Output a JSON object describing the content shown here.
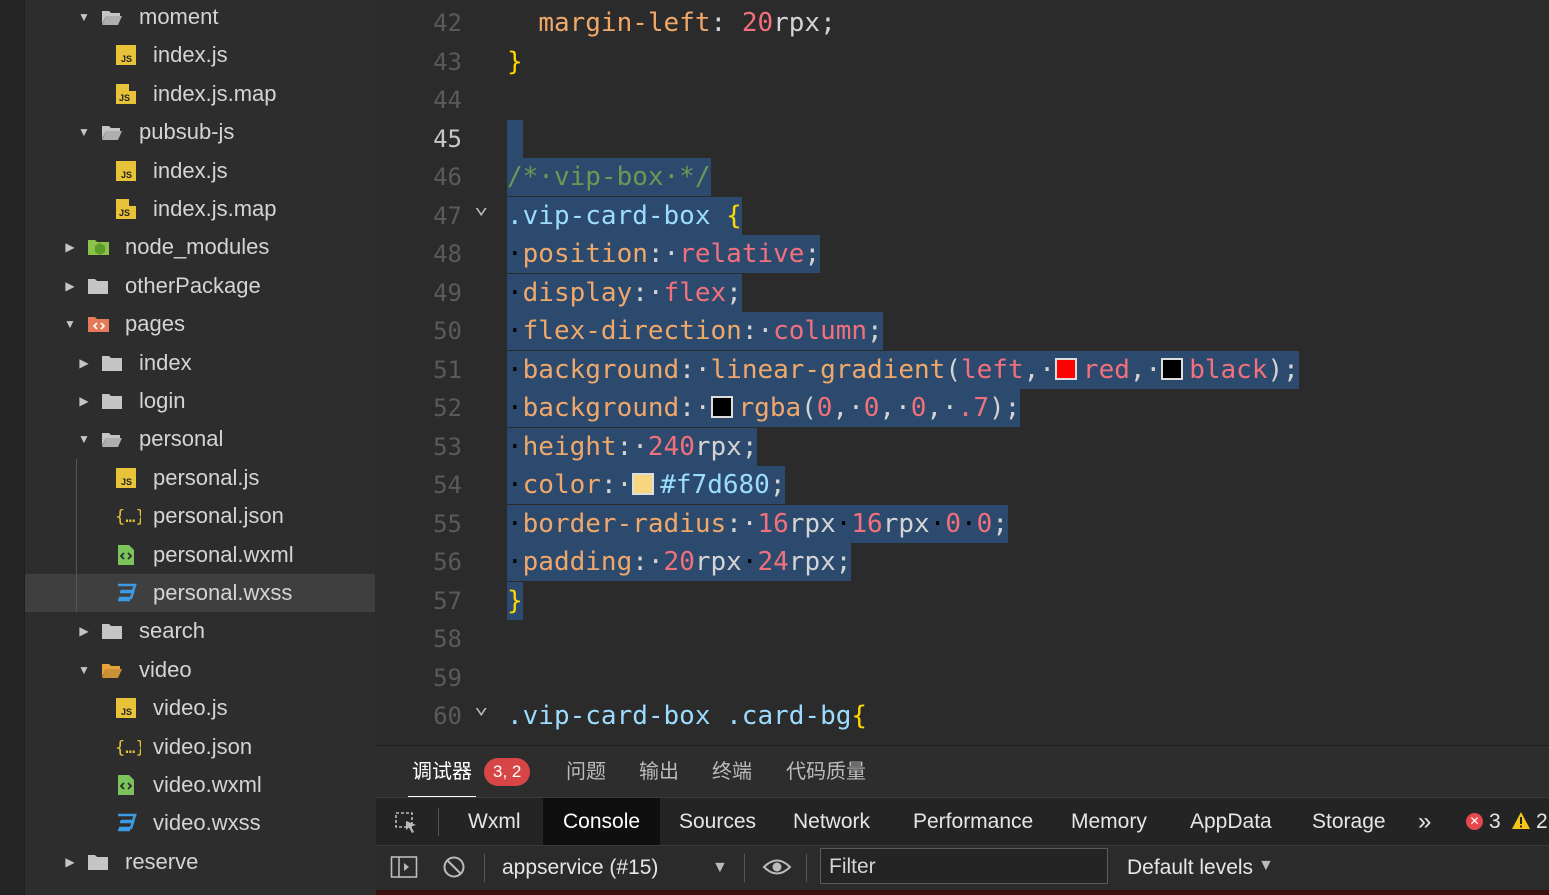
{
  "sidebar": {
    "items": [
      {
        "label": "moment",
        "type": "folder-open",
        "depth": 1,
        "expanded": true
      },
      {
        "label": "index.js",
        "type": "js",
        "depth": 2
      },
      {
        "label": "index.js.map",
        "type": "jsmap",
        "depth": 2
      },
      {
        "label": "pubsub-js",
        "type": "folder-open",
        "depth": 1,
        "expanded": true
      },
      {
        "label": "index.js",
        "type": "js",
        "depth": 2
      },
      {
        "label": "index.js.map",
        "type": "jsmap",
        "depth": 2
      },
      {
        "label": "node_modules",
        "type": "node",
        "depth": 0,
        "expanded": false
      },
      {
        "label": "otherPackage",
        "type": "folder",
        "depth": 0,
        "expanded": false
      },
      {
        "label": "pages",
        "type": "pages",
        "depth": 0,
        "expanded": true
      },
      {
        "label": "index",
        "type": "folder",
        "depth": 1,
        "expanded": false
      },
      {
        "label": "login",
        "type": "folder",
        "depth": 1,
        "expanded": false
      },
      {
        "label": "personal",
        "type": "folder-open",
        "depth": 1,
        "expanded": true
      },
      {
        "label": "personal.js",
        "type": "js",
        "depth": 2
      },
      {
        "label": "personal.json",
        "type": "json",
        "depth": 2
      },
      {
        "label": "personal.wxml",
        "type": "wxml",
        "depth": 2
      },
      {
        "label": "personal.wxss",
        "type": "wxss",
        "depth": 2,
        "selected": true
      },
      {
        "label": "search",
        "type": "folder",
        "depth": 1,
        "expanded": false
      },
      {
        "label": "video",
        "type": "video",
        "depth": 1,
        "expanded": true
      },
      {
        "label": "video.js",
        "type": "js",
        "depth": 2
      },
      {
        "label": "video.json",
        "type": "json",
        "depth": 2
      },
      {
        "label": "video.wxml",
        "type": "wxml",
        "depth": 2
      },
      {
        "label": "video.wxss",
        "type": "wxss",
        "depth": 2
      },
      {
        "label": "reserve",
        "type": "folder",
        "depth": 0,
        "expanded": false
      }
    ]
  },
  "editor": {
    "current_line": 45,
    "lines": [
      {
        "n": "42",
        "tokens": [
          [
            "  ",
            "dot"
          ],
          [
            "margin-left",
            "prop"
          ],
          [
            ": ",
            "punc"
          ],
          [
            "20",
            "num"
          ],
          [
            "rpx",
            "unit"
          ],
          [
            ";",
            "punc"
          ]
        ]
      },
      {
        "n": "43",
        "tokens": [
          [
            "}",
            "brace"
          ]
        ]
      },
      {
        "n": "44",
        "tokens": []
      },
      {
        "n": "45",
        "tokens": [
          [
            " ",
            "punc"
          ]
        ],
        "sel": true
      },
      {
        "n": "46",
        "tokens": [
          [
            "/*·vip-box·*/",
            "comment"
          ]
        ],
        "sel": true
      },
      {
        "n": "47",
        "fold": true,
        "tokens": [
          [
            ".vip-card-box",
            "sel"
          ],
          [
            " ",
            "dot"
          ],
          [
            "{",
            "brace"
          ]
        ],
        "sel": true
      },
      {
        "n": "48",
        "tokens": [
          [
            "·",
            "dot"
          ],
          [
            "position",
            "prop"
          ],
          [
            ":·",
            "punc"
          ],
          [
            "relative",
            "val"
          ],
          [
            ";",
            "punc"
          ]
        ],
        "sel": true
      },
      {
        "n": "49",
        "tokens": [
          [
            "·",
            "dot"
          ],
          [
            "display",
            "prop"
          ],
          [
            ":·",
            "punc"
          ],
          [
            "flex",
            "val"
          ],
          [
            ";",
            "punc"
          ]
        ],
        "sel": true
      },
      {
        "n": "50",
        "tokens": [
          [
            "·",
            "dot"
          ],
          [
            "flex-direction",
            "prop"
          ],
          [
            ":·",
            "punc"
          ],
          [
            "column",
            "val"
          ],
          [
            ";",
            "punc"
          ]
        ],
        "sel": true
      },
      {
        "n": "51",
        "tokens": [
          [
            "·",
            "dot"
          ],
          [
            "background",
            "prop"
          ],
          [
            ":·",
            "punc"
          ],
          [
            "linear-gradient",
            "fn"
          ],
          [
            "(",
            "punc"
          ],
          [
            "left",
            "val"
          ],
          [
            ",·",
            "punc"
          ],
          [
            "#ff0000",
            "swatch"
          ],
          [
            "red",
            "val"
          ],
          [
            ",·",
            "punc"
          ],
          [
            "#000000",
            "swatch"
          ],
          [
            "black",
            "val"
          ],
          [
            ");",
            "punc"
          ]
        ],
        "sel": true
      },
      {
        "n": "52",
        "tokens": [
          [
            "·",
            "dot"
          ],
          [
            "background",
            "prop"
          ],
          [
            ":·",
            "punc"
          ],
          [
            "#000000",
            "swatch"
          ],
          [
            "rgba",
            "fn"
          ],
          [
            "(",
            "punc"
          ],
          [
            "0",
            "num"
          ],
          [
            ",·",
            "punc"
          ],
          [
            "0",
            "num"
          ],
          [
            ",·",
            "punc"
          ],
          [
            "0",
            "num"
          ],
          [
            ",·",
            "punc"
          ],
          [
            ".7",
            "num"
          ],
          [
            ");",
            "punc"
          ]
        ],
        "sel": true
      },
      {
        "n": "53",
        "tokens": [
          [
            "·",
            "dot"
          ],
          [
            "height",
            "prop"
          ],
          [
            ":·",
            "punc"
          ],
          [
            "240",
            "num"
          ],
          [
            "rpx",
            "unit"
          ],
          [
            ";",
            "punc"
          ]
        ],
        "sel": true
      },
      {
        "n": "54",
        "tokens": [
          [
            "·",
            "dot"
          ],
          [
            "color",
            "prop"
          ],
          [
            ":·",
            "punc"
          ],
          [
            "#f7d680",
            "swatch"
          ],
          [
            "#f7d680",
            "hex"
          ],
          [
            ";",
            "punc"
          ]
        ],
        "sel": true
      },
      {
        "n": "55",
        "tokens": [
          [
            "·",
            "dot"
          ],
          [
            "border-radius",
            "prop"
          ],
          [
            ":·",
            "punc"
          ],
          [
            "16",
            "num"
          ],
          [
            "rpx",
            "unit"
          ],
          [
            "·",
            "dot"
          ],
          [
            "16",
            "num"
          ],
          [
            "rpx",
            "unit"
          ],
          [
            "·",
            "dot"
          ],
          [
            "0",
            "num"
          ],
          [
            "·",
            "dot"
          ],
          [
            "0",
            "num"
          ],
          [
            ";",
            "punc"
          ]
        ],
        "sel": true
      },
      {
        "n": "56",
        "tokens": [
          [
            "·",
            "dot"
          ],
          [
            "padding",
            "prop"
          ],
          [
            ":·",
            "punc"
          ],
          [
            "20",
            "num"
          ],
          [
            "rpx",
            "unit"
          ],
          [
            "·",
            "dot"
          ],
          [
            "24",
            "num"
          ],
          [
            "rpx",
            "unit"
          ],
          [
            ";",
            "punc"
          ]
        ],
        "sel": true
      },
      {
        "n": "57",
        "tokens": [
          [
            "}",
            "brace"
          ]
        ],
        "sel": true
      },
      {
        "n": "58",
        "tokens": []
      },
      {
        "n": "59",
        "tokens": []
      },
      {
        "n": "60",
        "fold": true,
        "tokens": [
          [
            ".vip-card-box",
            "sel"
          ],
          [
            " ",
            "punc"
          ],
          [
            ".card-bg",
            "sel"
          ],
          [
            "{",
            "brace"
          ]
        ]
      }
    ]
  },
  "panel": {
    "tabs": [
      "调试器",
      "问题",
      "输出",
      "终端",
      "代码质量"
    ],
    "active": 0,
    "badge": "3, 2"
  },
  "devtools": {
    "tabs": [
      "Wxml",
      "Console",
      "Sources",
      "Network",
      "Performance",
      "Memory",
      "AppData",
      "Storage"
    ],
    "active": "Console",
    "more": "»",
    "errors": "3",
    "warnings": "2"
  },
  "console_bar": {
    "context": "appservice (#15)",
    "filter_placeholder": "Filter",
    "levels": "Default levels"
  },
  "colors": {
    "selection": "#264f78",
    "error": "#d74646",
    "warning": "#f5c518"
  }
}
